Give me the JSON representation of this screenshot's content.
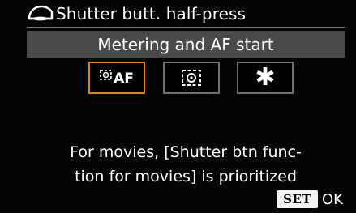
{
  "header": {
    "title": "Shutter butt. half-press",
    "icon": "camera-shutter-button-icon"
  },
  "selected_setting": {
    "label": "Metering and AF start"
  },
  "options": [
    {
      "id": "metering-af",
      "glyph": "AF",
      "icon": "metering-af-icon",
      "selected": true
    },
    {
      "id": "metering-only",
      "icon": "metering-icon",
      "selected": false
    },
    {
      "id": "disable",
      "glyph": "✱",
      "icon": "asterisk-icon",
      "selected": false
    }
  ],
  "note": {
    "line1": "For movies, [Shutter btn func-",
    "line2": "tion for movies] is prioritized"
  },
  "footer": {
    "set_label": "SET",
    "ok_label": "OK"
  },
  "colors": {
    "accent": "#e07a32",
    "band": "#4a4a4a",
    "background": "#050505"
  }
}
